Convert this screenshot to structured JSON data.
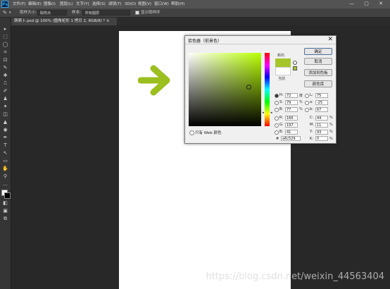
{
  "app": {
    "logo": "Ps"
  },
  "menu": [
    "文件(F)",
    "编辑(E)",
    "图像(I)",
    "图层(L)",
    "文字(Y)",
    "选择(S)",
    "滤镜(T)",
    "3D(D)",
    "视图(V)",
    "窗口(W)",
    "帮助(H)"
  ],
  "window_controls": "— ▢ ✕",
  "options": {
    "tool_icon": "eyedropper-icon",
    "sample_size_label": "取样大小:",
    "sample_size_value": "取样点",
    "sample_label": "样本:",
    "sample_value": "所有图层",
    "show_ring_label": "显示取样环"
  },
  "document_tab": "萌萌卜.psd @ 100% (圆角矩形 1 拷贝 2, RGB/8) * ×",
  "toolbox": [
    "▸",
    "⬚",
    "◯",
    "⌗",
    "⊡",
    "✎",
    "✚",
    "⎍",
    "✐",
    "♟",
    "✦",
    "◫",
    "▲",
    "◉",
    "✒",
    "T",
    "↖",
    "▭",
    "✋",
    "⚲",
    "…",
    "◧",
    "▣",
    "⧉"
  ],
  "dialog": {
    "title": "拾色器（前景色）",
    "close": "✕",
    "new_label": "新的",
    "current_label": "当前",
    "buttons": [
      "确定",
      "取消",
      "添加到色板",
      "颜色库"
    ],
    "hsb": [
      {
        "label": "H:",
        "value": "72",
        "unit": "度",
        "selected": true
      },
      {
        "label": "S:",
        "value": "79",
        "unit": "%",
        "selected": false
      },
      {
        "label": "B:",
        "value": "77",
        "unit": "%",
        "selected": false
      }
    ],
    "rgb": [
      {
        "label": "R:",
        "value": "166"
      },
      {
        "label": "G:",
        "value": "197"
      },
      {
        "label": "B:",
        "value": "41"
      }
    ],
    "lab": [
      {
        "label": "L:",
        "value": "75"
      },
      {
        "label": "a:",
        "value": "-25"
      },
      {
        "label": "b:",
        "value": "67"
      }
    ],
    "cmyk": [
      {
        "label": "C:",
        "value": "44",
        "unit": "%"
      },
      {
        "label": "M:",
        "value": "11",
        "unit": "%"
      },
      {
        "label": "Y:",
        "value": "93",
        "unit": "%"
      },
      {
        "label": "K:",
        "value": "0",
        "unit": "%"
      }
    ],
    "hex_label": "#",
    "hex_value": "a6c529",
    "web_only_label": "只有 Web 颜色"
  },
  "watermark": "https://blog.csdn.net/weixin_44563404",
  "colors": {
    "picked": "#a6c529",
    "arrow": "#9bbf1f"
  }
}
